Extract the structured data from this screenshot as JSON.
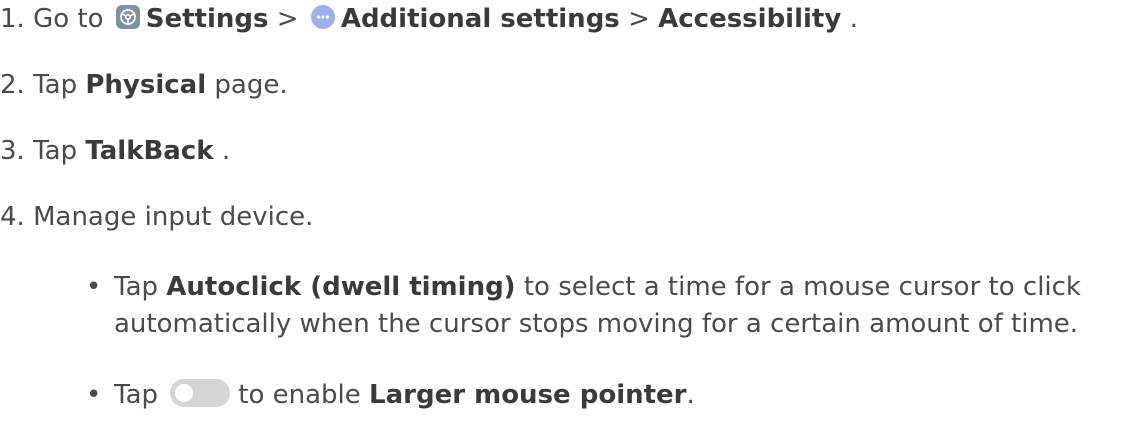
{
  "steps": [
    {
      "num": "1. Go to",
      "settings": "Settings",
      "sep1": ">",
      "additional": "Additional settings",
      "sep2": ">",
      "accessibility": "Accessibility",
      "end": "."
    },
    {
      "num": "2. Tap",
      "bold": "Physical",
      "rest": "page."
    },
    {
      "num": "3. Tap",
      "bold": "TalkBack",
      "rest": "."
    },
    {
      "num": "4.",
      "rest": "Manage input device."
    }
  ],
  "bullets": [
    {
      "marker": "•",
      "pre": "Tap",
      "bold": "Autoclick (dwell timing)",
      "rest1": "to select a time for a mouse cursor to click",
      "rest2": "automatically when the cursor stops moving for a certain amount of time."
    },
    {
      "marker": "•",
      "pre": "Tap",
      "mid": "to enable",
      "bold": "Larger mouse pointer",
      "end": "."
    }
  ],
  "icons": {
    "settings": "settings-icon",
    "additional": "more-dots-icon",
    "toggle": "toggle-off-icon"
  },
  "colors": {
    "text": "#4a4a4a",
    "settings_icon": "#7f92a3",
    "dots_icon": "#9fb1ec",
    "toggle_off": "#d5d5d5"
  }
}
